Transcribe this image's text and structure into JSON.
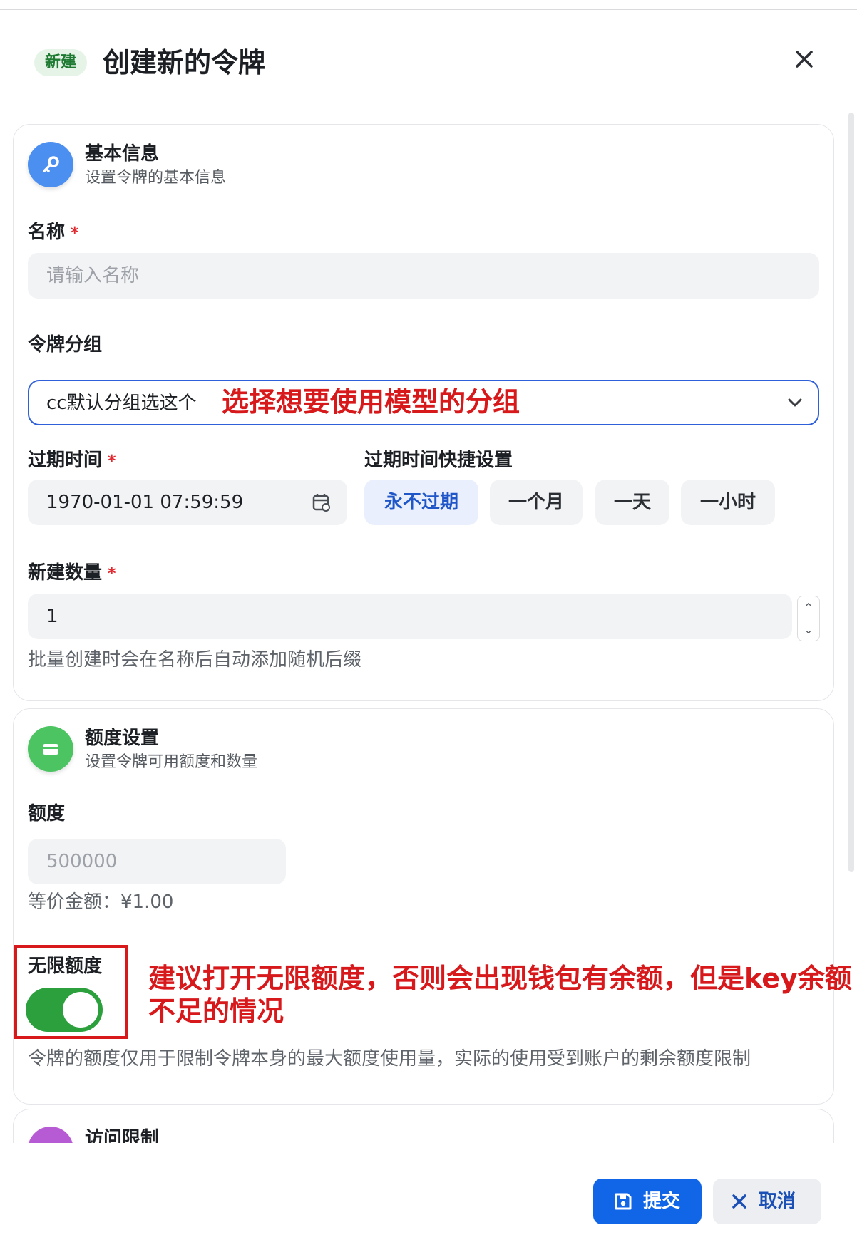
{
  "header": {
    "tag": "新建",
    "title": "创建新的令牌"
  },
  "basic": {
    "title": "基本信息",
    "subtitle": "设置令牌的基本信息",
    "name_label": "名称",
    "name_placeholder": "请输入名称",
    "group_label": "令牌分组",
    "group_value": "cc默认分组选这个",
    "group_annotation": "选择想要使用模型的分组",
    "expire_label": "过期时间",
    "expire_value": "1970-01-01 07:59:59",
    "quick_label": "过期时间快捷设置",
    "quick_options": [
      "永不过期",
      "一个月",
      "一天",
      "一小时"
    ],
    "count_label": "新建数量",
    "count_value": "1",
    "count_hint": "批量创建时会在名称后自动添加随机后缀",
    "required_mark": "*"
  },
  "quota": {
    "title": "额度设置",
    "subtitle": "设置令牌可用额度和数量",
    "quota_label": "额度",
    "quota_placeholder": "500000",
    "equivalent": "等价金额：¥1.00",
    "unlimited_label": "无限额度",
    "unlimited_on": true,
    "annotation": "建议打开无限额度，否则会出现钱包有余额，但是key余额不足的情况",
    "hint": "令牌的额度仅用于限制令牌本身的最大额度使用量，实际的使用受到账户的剩余额度限制"
  },
  "access": {
    "title": "访问限制"
  },
  "footer": {
    "submit": "提交",
    "cancel": "取消"
  },
  "colors": {
    "accent": "#1166e8",
    "toggle_on": "#2ba03d",
    "annotation": "#d7191c"
  },
  "icons": {
    "close": "close-icon",
    "basic": "key-icon",
    "quota": "credit-card-icon",
    "access": "link-icon",
    "calendar": "calendar-icon",
    "chevron": "chevron-down-icon",
    "save": "save-icon"
  }
}
